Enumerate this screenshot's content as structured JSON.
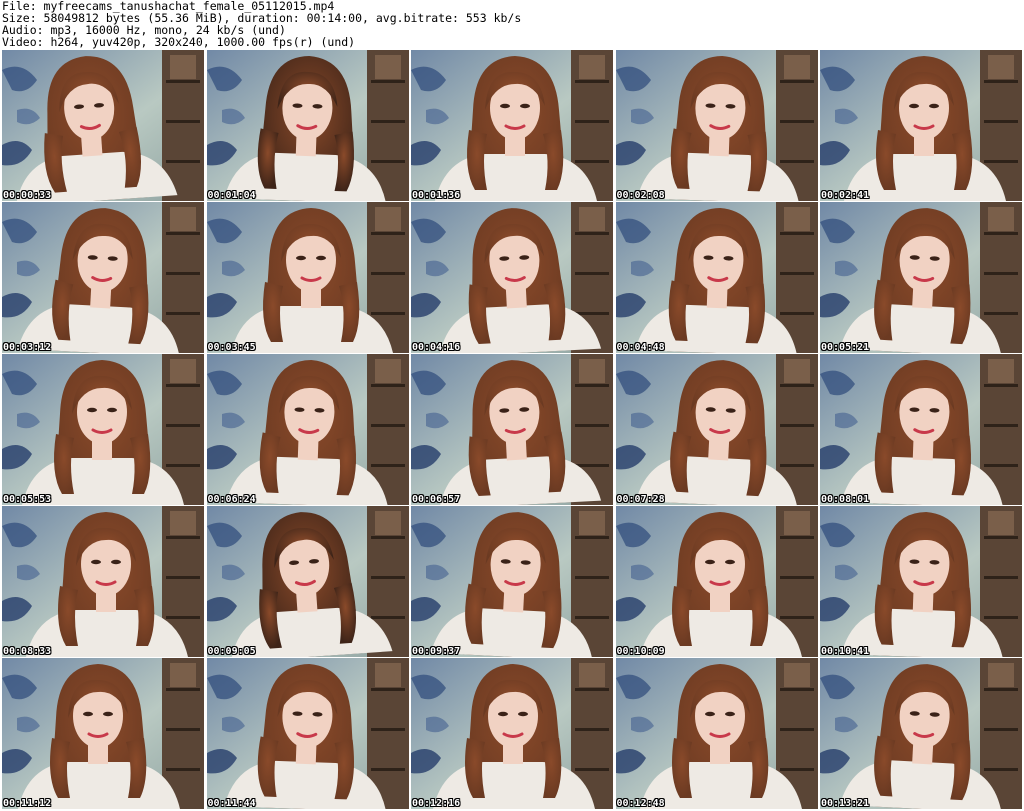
{
  "header": {
    "file_line": "File: myfreecams_tanushachat_female_05112015.mp4",
    "size_line": "Size: 58049812 bytes (55.36 MiB), duration: 00:14:00, avg.bitrate: 553 kb/s",
    "audio_line": "Audio: mp3, 16000 Hz, mono, 24 kb/s (und)",
    "video_line": "Video: h264, yuv420p, 320x240, 1000.00 fps(r) (und)"
  },
  "thumbnails": [
    {
      "timestamp": "00:00:33"
    },
    {
      "timestamp": "00:01:04"
    },
    {
      "timestamp": "00:01:36"
    },
    {
      "timestamp": "00:02:08"
    },
    {
      "timestamp": "00:02:41"
    },
    {
      "timestamp": "00:03:12"
    },
    {
      "timestamp": "00:03:45"
    },
    {
      "timestamp": "00:04:16"
    },
    {
      "timestamp": "00:04:48"
    },
    {
      "timestamp": "00:05:21"
    },
    {
      "timestamp": "00:05:53"
    },
    {
      "timestamp": "00:06:24"
    },
    {
      "timestamp": "00:06:57"
    },
    {
      "timestamp": "00:07:28"
    },
    {
      "timestamp": "00:08:01"
    },
    {
      "timestamp": "00:08:33"
    },
    {
      "timestamp": "00:09:05"
    },
    {
      "timestamp": "00:09:37"
    },
    {
      "timestamp": "00:10:09"
    },
    {
      "timestamp": "00:10:41"
    },
    {
      "timestamp": "00:11:12"
    },
    {
      "timestamp": "00:11:44"
    },
    {
      "timestamp": "00:12:16"
    },
    {
      "timestamp": "00:12:48"
    },
    {
      "timestamp": "00:13:21"
    }
  ],
  "colors": {
    "background": "#ffffff",
    "wallpaper": "#7189a6",
    "wallpaper_light": "#b9c9c2",
    "shelf": "#5a4536",
    "hair": "#6b3a22",
    "skin": "#f1d2c3",
    "shirt": "#eeeae4",
    "timestamp_text": "#ffffff",
    "timestamp_outline": "#000000"
  }
}
